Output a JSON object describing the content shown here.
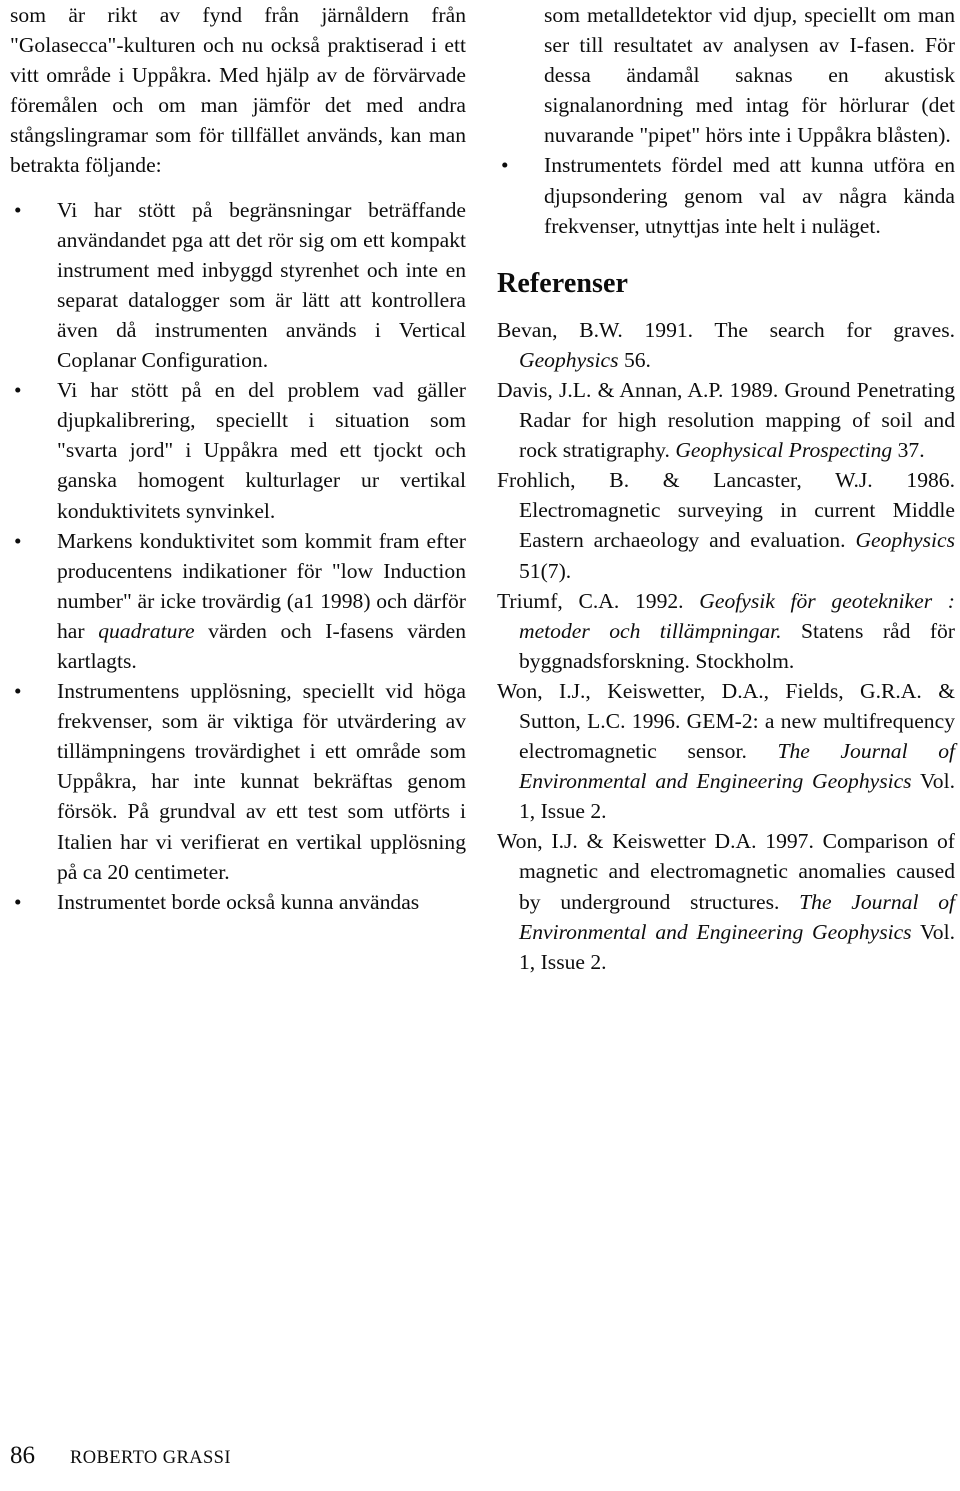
{
  "page": {
    "number": "86",
    "running_head": "ROBERTO GRASSI"
  },
  "left_column": {
    "intro_paragraph": "som är rikt av fynd från järnåldern från \"Golasecca\"-kulturen och nu också praktiserad i ett vitt område i Uppåkra. Med hjälp av de förvärvade föremålen och om man jämför det med andra stångslingramar som för tillfället används, kan man betrakta följande:",
    "bullet_glyph": "•",
    "bullets": [
      {
        "text_before_italic": "Vi har stött på begränsningar beträffande användandet pga att det rör sig om ett kompakt instrument med inbyggd styrenhet och inte en separat datalogger som är lätt att kontrollera även då instrumenten används i Vertical Coplanar Configuration."
      },
      {
        "text_before_italic": "Vi har stött på en del problem vad gäller djupkalibrering, speciellt i situation som \"svarta jord\" i Uppåkra med ett tjockt och ganska homogent kulturlager ur vertikal konduktivitets synvinkel."
      },
      {
        "text_before_italic": "Markens konduktivitet som kommit fram efter producentens indikationer för \"low Induction number\" är icke trovärdig (a1 1998) och därför har ",
        "italic": "quadrature",
        "text_after_italic": " värden och I-fasens värden kartlagts."
      },
      {
        "text_before_italic": "Instrumentens upplösning, speciellt vid höga frekvenser, som är viktiga för utvärdering av tillämpningens trovärdighet i ett område som Uppåkra, har inte kunnat bekräftas genom försök. På grundval av ett test som utförts i Italien har vi verifierat en vertikal upplösning på ca 20 centimeter."
      },
      {
        "text_before_italic": "Instrumentet borde också kunna användas"
      }
    ]
  },
  "right_column": {
    "continuation_paragraph": "som metalldetektor vid djup, speciellt om man ser till resultatet av analysen av I-fasen. För dessa ändamål saknas en akustisk signalanordning med intag för hörlurar (det nuvarande \"pipet\" hörs inte i Uppåkra blåsten).",
    "bullet_glyph": "•",
    "bullets": [
      {
        "text_before_italic": "Instrumentets fördel med att kunna utföra en djupsondering genom val av några kända frekvenser, utnyttjas inte helt i nuläget."
      }
    ],
    "references_heading": "Referenser",
    "references": [
      {
        "part1": "Bevan, B.W. 1991. The search for graves. ",
        "italic1": "Geophysics",
        "part2": " 56."
      },
      {
        "part1": "Davis, J.L. & Annan, A.P. 1989. Ground Penetrating Radar for high resolution mapping of soil and rock stratigraphy. ",
        "italic1": "Geophysical Prospecting",
        "part2": " 37."
      },
      {
        "part1": "Frohlich, B. & Lancaster, W.J. 1986. Electromagnetic surveying in current Middle Eastern archaeology and evaluation. ",
        "italic1": "Geophysics",
        "part2": " 51(7)."
      },
      {
        "part1": "Triumf, C.A. 1992. ",
        "italic1": "Geofysik för geotekniker : metoder och tillämpningar.",
        "part2": " Statens råd för byggnadsforskning. Stockholm."
      },
      {
        "part1": "Won, I.J., Keiswetter, D.A., Fields, G.R.A. & Sutton, L.C. 1996. GEM-2: a new multifrequency electromagnetic sensor. ",
        "italic1": "The Journal of Environmental and Engineering Geophysics",
        "part2": " Vol. 1, Issue 2."
      },
      {
        "part1": "Won, I.J. & Keiswetter D.A. 1997. Comparison of magnetic and electromagnetic anomalies caused by underground structures. ",
        "italic1": "The Journal of Environmental and Engineering Geophysics",
        "part2": " Vol. 1, Issue 2."
      }
    ]
  }
}
